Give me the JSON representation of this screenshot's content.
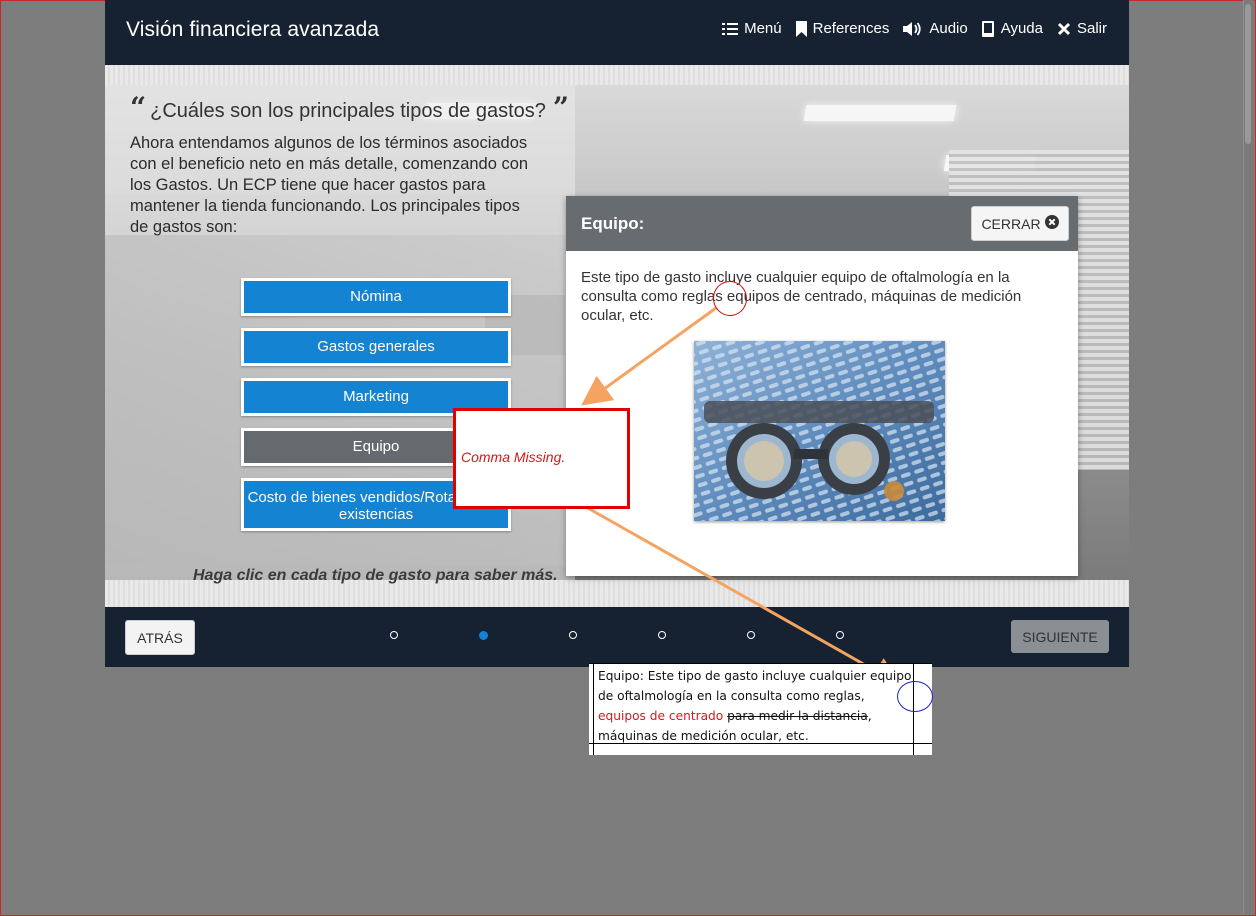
{
  "header": {
    "course_title": "Visión financiera avanzada",
    "menu": [
      {
        "label": "Menú",
        "icon": "list-icon"
      },
      {
        "label": "References",
        "icon": "bookmark-icon"
      },
      {
        "label": "Audio",
        "icon": "speaker-icon"
      },
      {
        "label": "Ayuda",
        "icon": "book-icon"
      },
      {
        "label": "Salir",
        "icon": "close-icon"
      }
    ]
  },
  "question": {
    "title": "¿Cuáles son los principales tipos de gastos?",
    "open_quote": "“",
    "close_quote": "”",
    "body": "Ahora entendamos algunos de los términos asociados con el beneficio neto en más detalle, comenzando con los Gastos. Un ECP tiene que hacer gastos para mantener la tienda funcionando. Los principales tipos de gastos son:"
  },
  "expense_buttons": [
    {
      "label": "Nómina",
      "state": "default"
    },
    {
      "label": "Gastos generales",
      "state": "default"
    },
    {
      "label": "Marketing",
      "state": "default"
    },
    {
      "label": "Equipo",
      "state": "selected"
    },
    {
      "label": "Costo de bienes vendidos/Rotación de existencias",
      "state": "default"
    }
  ],
  "hint": "Haga clic en cada tipo de gasto para saber más.",
  "popup": {
    "title": "Equipo:",
    "close_label": "CERRAR",
    "text": "Este tipo de gasto incluye cualquier equipo de oftalmología en la consulta como reglas equipos de centrado, máquinas de medición ocular, etc.",
    "image_icon": "phoropter-image"
  },
  "navigation": {
    "back_label": "ATRÁS",
    "next_label": "SIGUIENTE",
    "dots_count": 6,
    "active_dot": 1
  },
  "annotation": {
    "comment": "Comma Missing.",
    "colors": {
      "box_border": "#e00000",
      "arrow": "#f4a460",
      "circle_red": "#d01010",
      "circle_blue": "#1a23d6"
    }
  },
  "source_table": {
    "line1": "Equipo: Este tipo de gasto incluye cualquier equipo de oftalmología en la consulta como reglas,",
    "inserted": "equipos de centrado",
    "deleted": "para medir la distancia",
    "after_deleted": ",",
    "line_end": "máquinas de medición ocular, etc."
  },
  "colors": {
    "topbar": "#162231",
    "button_blue": "#1483d1",
    "button_gray": "#646a6e",
    "popup_header": "#666c70",
    "background": "#7d7d7d"
  }
}
